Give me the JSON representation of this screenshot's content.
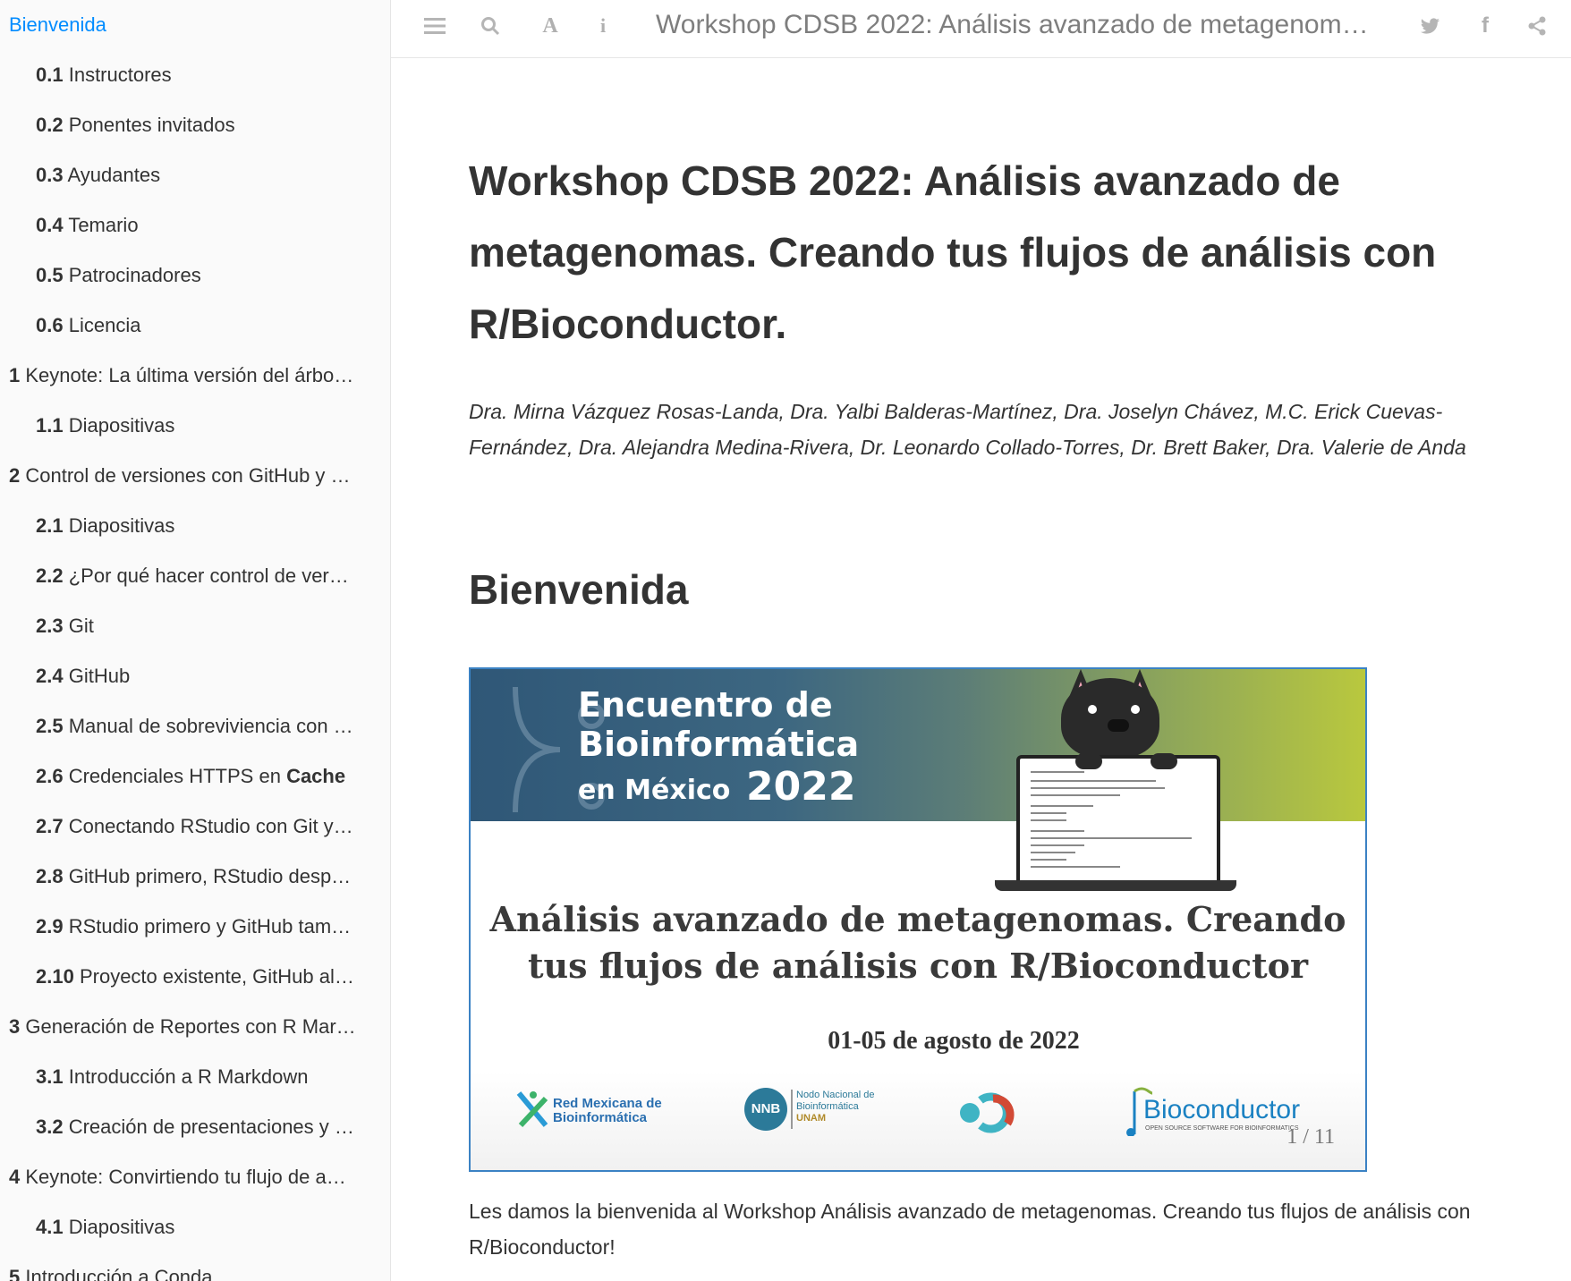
{
  "sidebar": {
    "items": [
      {
        "num": "",
        "label": "Bienvenida",
        "active": true
      },
      {
        "num": "0.1",
        "label": "Instructores"
      },
      {
        "num": "0.2",
        "label": "Ponentes invitados"
      },
      {
        "num": "0.3",
        "label": "Ayudantes"
      },
      {
        "num": "0.4",
        "label": "Temario"
      },
      {
        "num": "0.5",
        "label": "Patrocinadores"
      },
      {
        "num": "0.6",
        "label": "Licencia"
      },
      {
        "num": "1",
        "label": "Keynote: La última versión del árbo…"
      },
      {
        "num": "1.1",
        "label": "Diapositivas"
      },
      {
        "num": "2",
        "label": "Control de versiones con GitHub y …"
      },
      {
        "num": "2.1",
        "label": "Diapositivas"
      },
      {
        "num": "2.2",
        "label": "¿Por qué hacer control de ver…"
      },
      {
        "num": "2.3",
        "label": "Git"
      },
      {
        "num": "2.4",
        "label": "GitHub"
      },
      {
        "num": "2.5",
        "label": "Manual de sobreviviencia con …"
      },
      {
        "num": "2.6",
        "label": "Credenciales HTTPS en",
        "bold_suffix": "Cache"
      },
      {
        "num": "2.7",
        "label": "Conectando RStudio con Git y…"
      },
      {
        "num": "2.8",
        "label": "GitHub primero, RStudio desp…"
      },
      {
        "num": "2.9",
        "label": "RStudio primero y GitHub tam…"
      },
      {
        "num": "2.10",
        "label": "Proyecto existente, GitHub al…"
      },
      {
        "num": "3",
        "label": "Generación de Reportes con R Mar…"
      },
      {
        "num": "3.1",
        "label": "Introducción a R Markdown"
      },
      {
        "num": "3.2",
        "label": "Creación de presentaciones y …"
      },
      {
        "num": "4",
        "label": "Keynote: Convirtiendo tu flujo de a…"
      },
      {
        "num": "4.1",
        "label": "Diapositivas"
      },
      {
        "num": "5",
        "label": "Introducción a Conda."
      }
    ]
  },
  "header": {
    "book_title": "Workshop CDSB 2022: Análisis avanzado de metagenomas…",
    "icons": [
      "menu-icon",
      "search-icon",
      "font-icon",
      "info-icon",
      "twitter-icon",
      "facebook-icon",
      "share-icon"
    ]
  },
  "main": {
    "title": "Workshop CDSB 2022: Análisis avanzado de metagenomas. Creando tus flujos de análisis con R/Bioconductor.",
    "authors": "Dra. Mirna Vázquez Rosas-Landa, Dra. Yalbi Balderas-Martínez, Dra. Joselyn Chávez, M.C. Erick Cuevas-Fernández, Dra. Alejandra Medina-Rivera, Dr. Leonardo Collado-Torres, Dr. Brett Baker, Dra. Valerie de Anda",
    "section_heading": "Bienvenida",
    "welcome_text": "Les damos la bienvenida al Workshop Análisis avanzado de metagenomas. Creando tus flujos de análisis con R/Bioconductor!"
  },
  "slide": {
    "banner_line1": "Encuentro de",
    "banner_line2": "Bioinformática",
    "banner_line3a": "en México",
    "banner_line3b": "2022",
    "heading": "Análisis avanzado de metagenomas. Creando tus flujos de análisis con R/Bioconductor",
    "date": "01-05 de agosto de 2022",
    "logo1": "Red Mexicana de Bioinformática",
    "logo2_title": "Nodo Nacional de Bioinformática",
    "logo2_sub": "UNAM",
    "logo2_badge": "NNB",
    "logo4_name": "Bioconductor",
    "logo4_tag": "OPEN SOURCE SOFTWARE FOR BIOINFORMATICS",
    "counter": "1 / 11"
  },
  "colors": {
    "accent": "#008cff",
    "slide_border": "#3b82c4"
  }
}
